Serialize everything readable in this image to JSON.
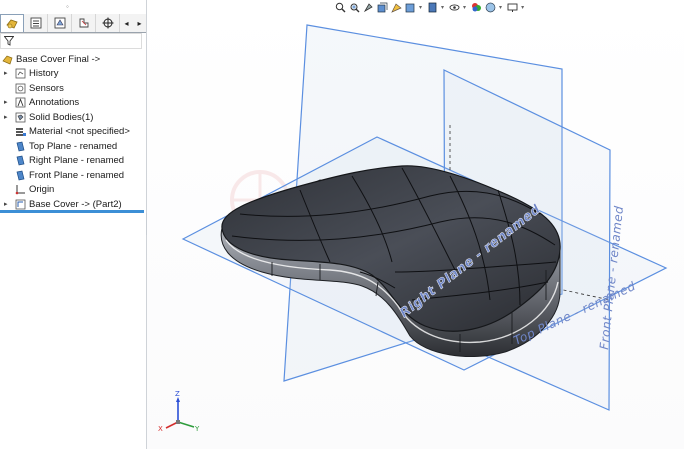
{
  "feature_manager": {
    "tabs": [
      {
        "name": "feature-manager-tab",
        "icon": "feature-tree-icon"
      },
      {
        "name": "property-manager-tab",
        "icon": "property-manager-icon"
      },
      {
        "name": "configuration-manager-tab",
        "icon": "configuration-manager-icon"
      },
      {
        "name": "dimxpert-manager-tab",
        "icon": "dimxpert-icon"
      },
      {
        "name": "display-manager-tab",
        "icon": "crosshair-icon"
      }
    ],
    "tree": [
      {
        "label": "Base Cover Final ->",
        "icon": "part-icon",
        "expander": ""
      },
      {
        "label": "History",
        "icon": "history-icon",
        "expander": "▸"
      },
      {
        "label": "Sensors",
        "icon": "sensor-icon",
        "expander": ""
      },
      {
        "label": "Annotations",
        "icon": "annotation-icon",
        "expander": "▸"
      },
      {
        "label": "Solid Bodies(1)",
        "icon": "solid-bodies-icon",
        "expander": "▸"
      },
      {
        "label": "Material <not specified>",
        "icon": "material-icon",
        "expander": ""
      },
      {
        "label": "Top Plane - renamed",
        "icon": "plane-icon",
        "expander": ""
      },
      {
        "label": "Right Plane - renamed",
        "icon": "plane-icon",
        "expander": ""
      },
      {
        "label": "Front Plane - renamed",
        "icon": "plane-icon",
        "expander": ""
      },
      {
        "label": "Origin",
        "icon": "origin-icon",
        "expander": ""
      },
      {
        "label": "Base Cover -> (Part2)",
        "icon": "feature-icon",
        "expander": "▸"
      }
    ]
  },
  "viewport": {
    "plane_labels": {
      "right": "Right Plane - renamed",
      "top": "Top Plane - renamed",
      "front": "Front Plane - renamed"
    },
    "triad": {
      "x": "X",
      "y": "Y",
      "z": "Z"
    },
    "colors": {
      "plane_edge": "#5b8fe0",
      "plane_label": "#6f86c8",
      "model": "#3a3d44"
    }
  }
}
